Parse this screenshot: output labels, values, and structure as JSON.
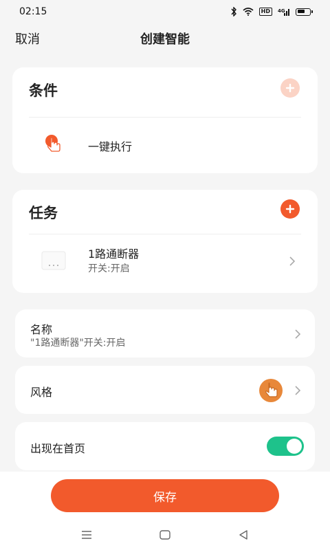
{
  "status": {
    "time": "02:15",
    "hd_label": "HD",
    "signal_label": "4G"
  },
  "header": {
    "cancel_label": "取消",
    "title": "创建智能"
  },
  "condition": {
    "title": "条件",
    "items": [
      {
        "label": "一键执行",
        "icon": "one-tap-hand-icon"
      }
    ]
  },
  "task": {
    "title": "任务",
    "items": [
      {
        "name": "1路通断器",
        "detail": "开关:开启",
        "icon": "switch-device-icon"
      }
    ]
  },
  "name_row": {
    "label": "名称",
    "value": "\"1路通断器\"开关:开启"
  },
  "style_row": {
    "label": "风格",
    "icon": "hand-tap-style-icon"
  },
  "homepage_row": {
    "label": "出现在首页",
    "toggle_on": true
  },
  "save_label": "保存",
  "colors": {
    "accent": "#f25a2c",
    "accent_light": "#fbd3c5",
    "toggle_on": "#1ec28b",
    "style_icon_bg": "#e8883a"
  },
  "system_nav": {
    "menu_icon": "menu-icon",
    "home_icon": "home-icon",
    "back_icon": "back-icon"
  }
}
